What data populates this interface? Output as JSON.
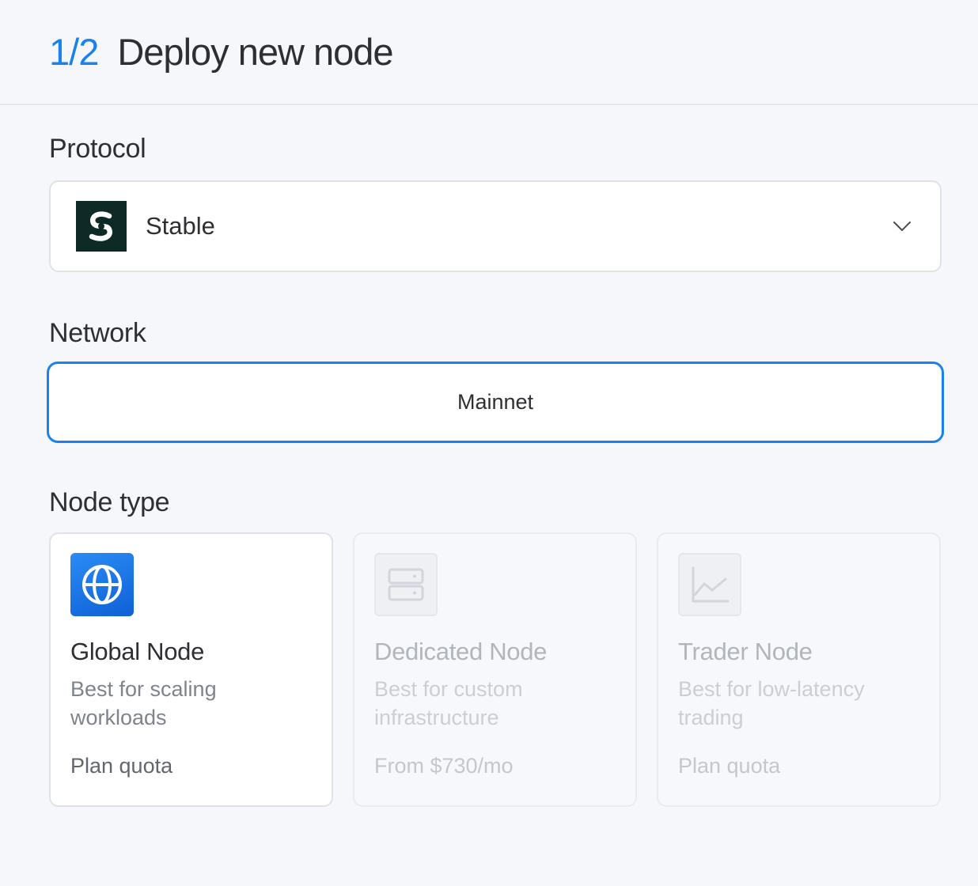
{
  "header": {
    "step": "1/2",
    "title": "Deploy new node"
  },
  "protocol": {
    "label": "Protocol",
    "selected": "Stable",
    "logo_icon": "stable-logo-icon",
    "dropdown_icon": "chevron-down-icon"
  },
  "network": {
    "label": "Network",
    "selected": "Mainnet",
    "accent": "#1a82f0"
  },
  "node_type": {
    "label": "Node type",
    "cards": [
      {
        "title": "Global Node",
        "description": "Best for scaling workloads",
        "price": "Plan quota",
        "icon": "globe-icon",
        "state": "selected"
      },
      {
        "title": "Dedicated Node",
        "description": "Best for custom infrastructure",
        "price": "From $730/mo",
        "icon": "server-icon",
        "state": "disabled"
      },
      {
        "title": "Trader Node",
        "description": "Best for low-latency trading",
        "price": "Plan quota",
        "icon": "chart-line-icon",
        "state": "disabled"
      }
    ]
  }
}
